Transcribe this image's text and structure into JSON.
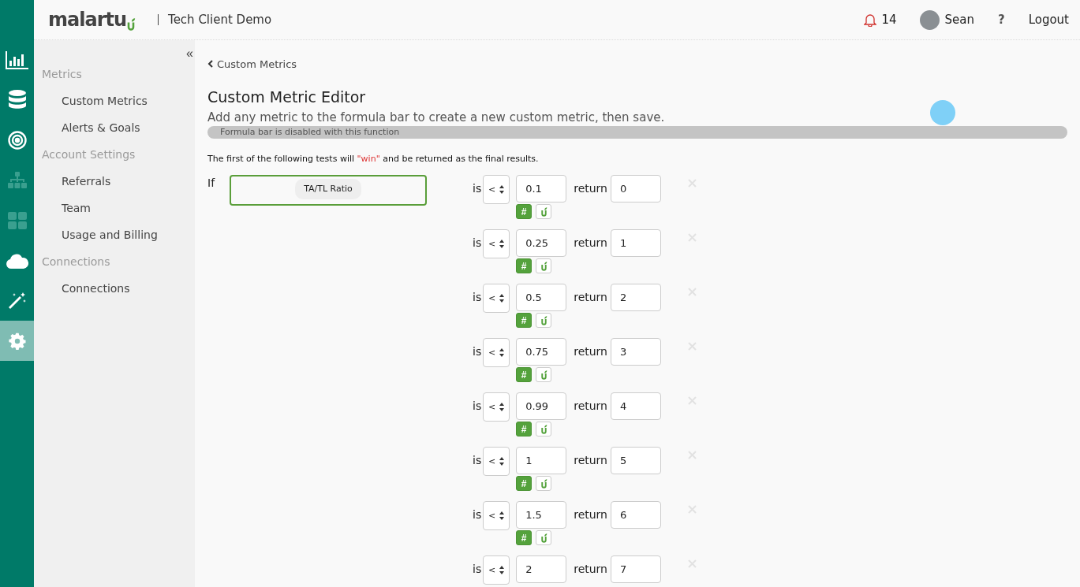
{
  "rail": [
    {
      "selected": false,
      "disabled": false
    },
    {
      "selected": false,
      "disabled": false
    },
    {
      "selected": false,
      "disabled": false
    },
    {
      "selected": false,
      "disabled": true
    },
    {
      "selected": false,
      "disabled": true
    },
    {
      "selected": false,
      "disabled": false
    },
    {
      "selected": false,
      "disabled": false
    },
    {
      "selected": true,
      "disabled": false
    }
  ],
  "header": {
    "logo": "malartu",
    "client": "Tech Client Demo",
    "notifications": "14",
    "user": "Sean",
    "help": "?",
    "logout": "Logout"
  },
  "sidebar": {
    "collapse": "«",
    "groups": [
      {
        "title": "Metrics",
        "items": [
          "Custom Metrics",
          "Alerts & Goals"
        ]
      },
      {
        "title": "Account Settings",
        "items": [
          "Referrals",
          "Team",
          "Usage and Billing"
        ]
      },
      {
        "title": "Connections",
        "items": [
          "Connections"
        ]
      }
    ]
  },
  "back_link": "Custom Metrics",
  "title": "Custom Metric Editor",
  "subtitle": "Add any metric to the formula bar to create a new custom metric, then save.",
  "formula_bar": {
    "text": "Formula bar is disabled with this function",
    "disabled": true
  },
  "instruction": {
    "before": "The first of the following tests will ",
    "highlight": "\"win\"",
    "after": " and be returned as the final results."
  },
  "condition": {
    "label": "If",
    "metric": "TA/TL Ratio"
  },
  "rules": [
    {
      "is": "is",
      "operator": "<",
      "value": "0.1",
      "return_label": "return",
      "result": "0",
      "toggles": [
        {
          "kind": "number",
          "label": "#",
          "selected": true
        },
        {
          "kind": "metric",
          "selected": false
        }
      ]
    },
    {
      "is": "is",
      "operator": "<",
      "value": "0.25",
      "return_label": "return",
      "result": "1",
      "toggles": [
        {
          "kind": "number",
          "label": "#",
          "selected": true
        },
        {
          "kind": "metric",
          "selected": false
        }
      ]
    },
    {
      "is": "is",
      "operator": "<",
      "value": "0.5",
      "return_label": "return",
      "result": "2",
      "toggles": [
        {
          "kind": "number",
          "label": "#",
          "selected": true
        },
        {
          "kind": "metric",
          "selected": false
        }
      ]
    },
    {
      "is": "is",
      "operator": "<",
      "value": "0.75",
      "return_label": "return",
      "result": "3",
      "toggles": [
        {
          "kind": "number",
          "label": "#",
          "selected": true
        },
        {
          "kind": "metric",
          "selected": false
        }
      ]
    },
    {
      "is": "is",
      "operator": "<",
      "value": "0.99",
      "return_label": "return",
      "result": "4",
      "toggles": [
        {
          "kind": "number",
          "label": "#",
          "selected": true
        },
        {
          "kind": "metric",
          "selected": false
        }
      ]
    },
    {
      "is": "is",
      "operator": "<",
      "value": "1",
      "return_label": "return",
      "result": "5",
      "toggles": [
        {
          "kind": "number",
          "label": "#",
          "selected": true
        },
        {
          "kind": "metric",
          "selected": false
        }
      ]
    },
    {
      "is": "is",
      "operator": "<",
      "value": "1.5",
      "return_label": "return",
      "result": "6",
      "toggles": [
        {
          "kind": "number",
          "label": "#",
          "selected": true
        },
        {
          "kind": "metric",
          "selected": false
        }
      ]
    },
    {
      "is": "is",
      "operator": "<",
      "value": "2",
      "return_label": "return",
      "result": "7"
    }
  ]
}
